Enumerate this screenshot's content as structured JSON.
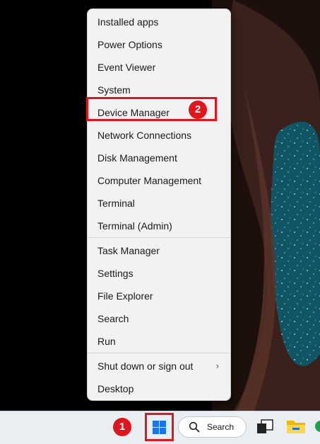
{
  "context_menu": {
    "items": [
      {
        "label": "Installed apps"
      },
      {
        "label": "Power Options"
      },
      {
        "label": "Event Viewer"
      },
      {
        "label": "System"
      },
      {
        "label": "Device Manager"
      },
      {
        "label": "Network Connections"
      },
      {
        "label": "Disk Management"
      },
      {
        "label": "Computer Management"
      },
      {
        "label": "Terminal"
      },
      {
        "label": "Terminal (Admin)"
      },
      {
        "label": "Task Manager"
      },
      {
        "label": "Settings"
      },
      {
        "label": "File Explorer"
      },
      {
        "label": "Search"
      },
      {
        "label": "Run"
      },
      {
        "label": "Shut down or sign out"
      },
      {
        "label": "Desktop"
      }
    ],
    "highlighted_item": "Device Manager"
  },
  "annotations": {
    "step_1": "1",
    "step_2": "2",
    "highlight_color": "#e3151c"
  },
  "taskbar": {
    "search_label": "Search",
    "icons": [
      "windows-start-icon",
      "search-icon",
      "task-view-icon",
      "file-explorer-icon",
      "edge-icon"
    ]
  }
}
